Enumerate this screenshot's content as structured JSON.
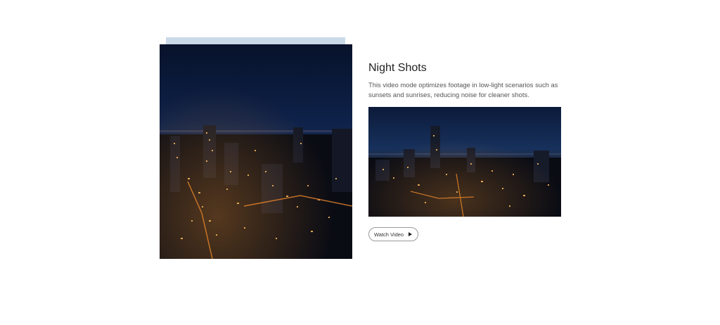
{
  "feature": {
    "title": "Night Shots",
    "description": "This video mode optimizes footage in low-light scenarios such as sunsets and sunrises, reducing noise for cleaner shots.",
    "watch_button_label": "Watch Video",
    "play_icon": "play-icon"
  },
  "colors": {
    "accent_bar": "#c9d9e8",
    "sky_top": "#0a1633",
    "sky_mid": "#132a55",
    "city_lights": "#f0a040"
  }
}
